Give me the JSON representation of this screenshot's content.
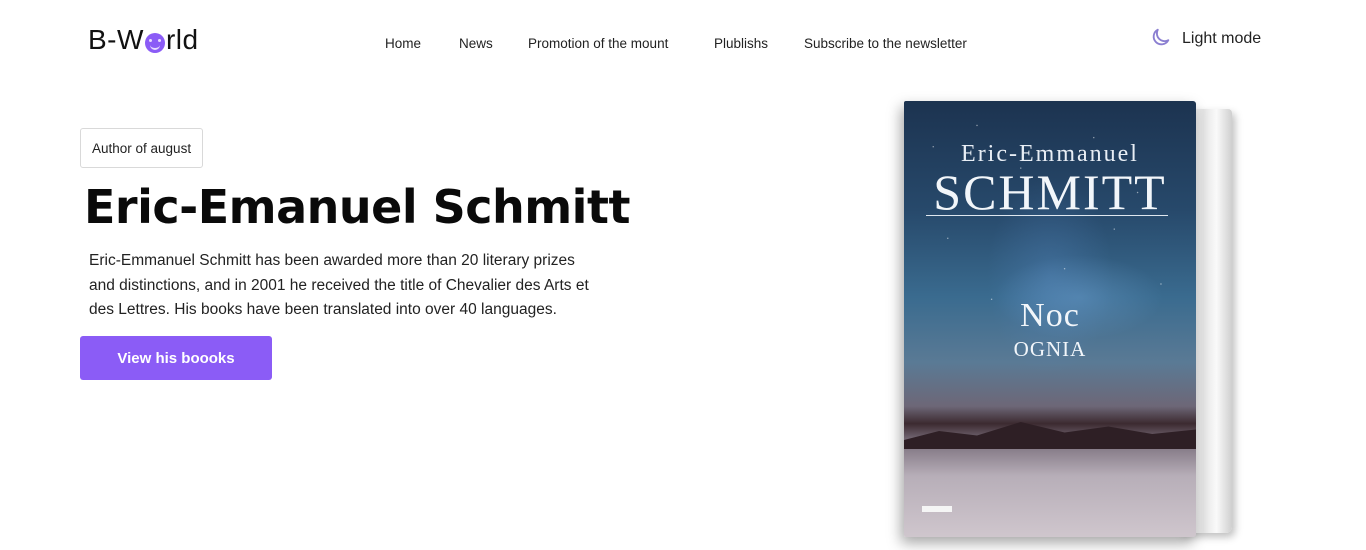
{
  "header": {
    "logo": {
      "prefix": "B-W",
      "suffix": "rld"
    },
    "nav": [
      {
        "label": "Home"
      },
      {
        "label": "News"
      },
      {
        "label": "Promotion of the mount"
      },
      {
        "label": "Plublishs"
      },
      {
        "label": "Subscribe to the newsletter"
      }
    ],
    "mode_toggle": {
      "label": "Light mode",
      "icon": "moon-icon"
    }
  },
  "hero": {
    "badge": "Author of august",
    "title": "Eric-Emanuel Schmitt",
    "description": "Eric-Emmanuel Schmitt has been awarded more than 20 literary prizes and distinctions, and in 2001 he received the title of Chevalier des Arts et des Lettres. His books have been translated into over 40 languages.",
    "cta": "View his boooks"
  },
  "book": {
    "author_line1": "Eric-Emmanuel",
    "author_line2": "SCHMITT",
    "title_line1": "Noc",
    "title_line2": "OGNIA"
  },
  "colors": {
    "accent": "#8b5cf6",
    "moon": "#8b7fd1"
  }
}
